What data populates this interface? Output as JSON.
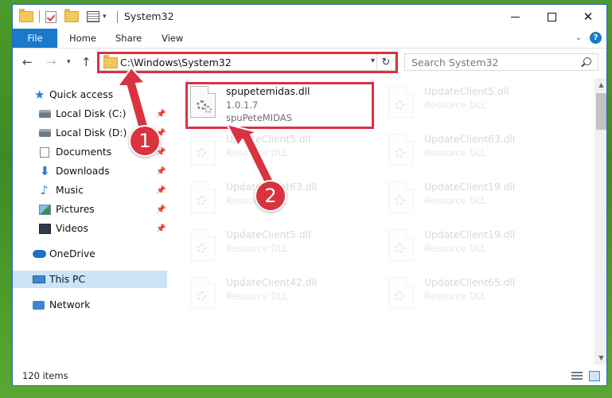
{
  "window": {
    "title": "System32",
    "controls": {
      "minimize": "—",
      "maximize": "",
      "close": "✕"
    }
  },
  "ribbon": {
    "tabs": [
      "File",
      "Home",
      "Share",
      "View"
    ],
    "help": "?"
  },
  "address": {
    "path": "C:\\Windows\\System32",
    "search_placeholder": "Search System32"
  },
  "sidebar": {
    "items": [
      {
        "label": "Quick access",
        "icon": "star-icon"
      },
      {
        "label": "Local Disk (C:)",
        "icon": "disk-icon",
        "pinned": true
      },
      {
        "label": "Local Disk (D:)",
        "icon": "disk-icon",
        "pinned": true
      },
      {
        "label": "Documents",
        "icon": "documents-icon",
        "pinned": true
      },
      {
        "label": "Downloads",
        "icon": "download-icon",
        "pinned": true
      },
      {
        "label": "Music",
        "icon": "music-icon",
        "pinned": true
      },
      {
        "label": "Pictures",
        "icon": "pictures-icon",
        "pinned": true
      },
      {
        "label": "Videos",
        "icon": "videos-icon",
        "pinned": true
      },
      {
        "label": "OneDrive",
        "icon": "onedrive-icon"
      },
      {
        "label": "This PC",
        "icon": "pc-icon",
        "selected": true
      },
      {
        "label": "Network",
        "icon": "network-icon"
      }
    ]
  },
  "files": [
    {
      "name": "spupetemidas.dll",
      "line2": "1.0.1.7",
      "line3": "spuPeteMIDAS",
      "highlighted": true
    },
    {
      "name": "UpdateClient5.dll",
      "line2": "Resource DLL"
    },
    {
      "name": "UpdateClient5.dll",
      "line2": "Resource DLL"
    },
    {
      "name": "UpdateClient63.dll",
      "line2": "Resource DLL"
    },
    {
      "name": "UpdateClient63.dll",
      "line2": "Resource DLL"
    },
    {
      "name": "UpdateClient19.dll",
      "line2": "Resource DLL"
    },
    {
      "name": "UpdateClient5.dll",
      "line2": "Resource DLL"
    },
    {
      "name": "UpdateClient19.dll",
      "line2": "Resource DLL"
    },
    {
      "name": "UpdateClient42.dll",
      "line2": "Resource DLL"
    },
    {
      "name": "UpdateClient65.dll",
      "line2": "Resource DLL"
    }
  ],
  "status": {
    "item_count": "120 items"
  },
  "annotations": {
    "badge1": "1",
    "badge2": "2",
    "color": "#d9333f"
  }
}
